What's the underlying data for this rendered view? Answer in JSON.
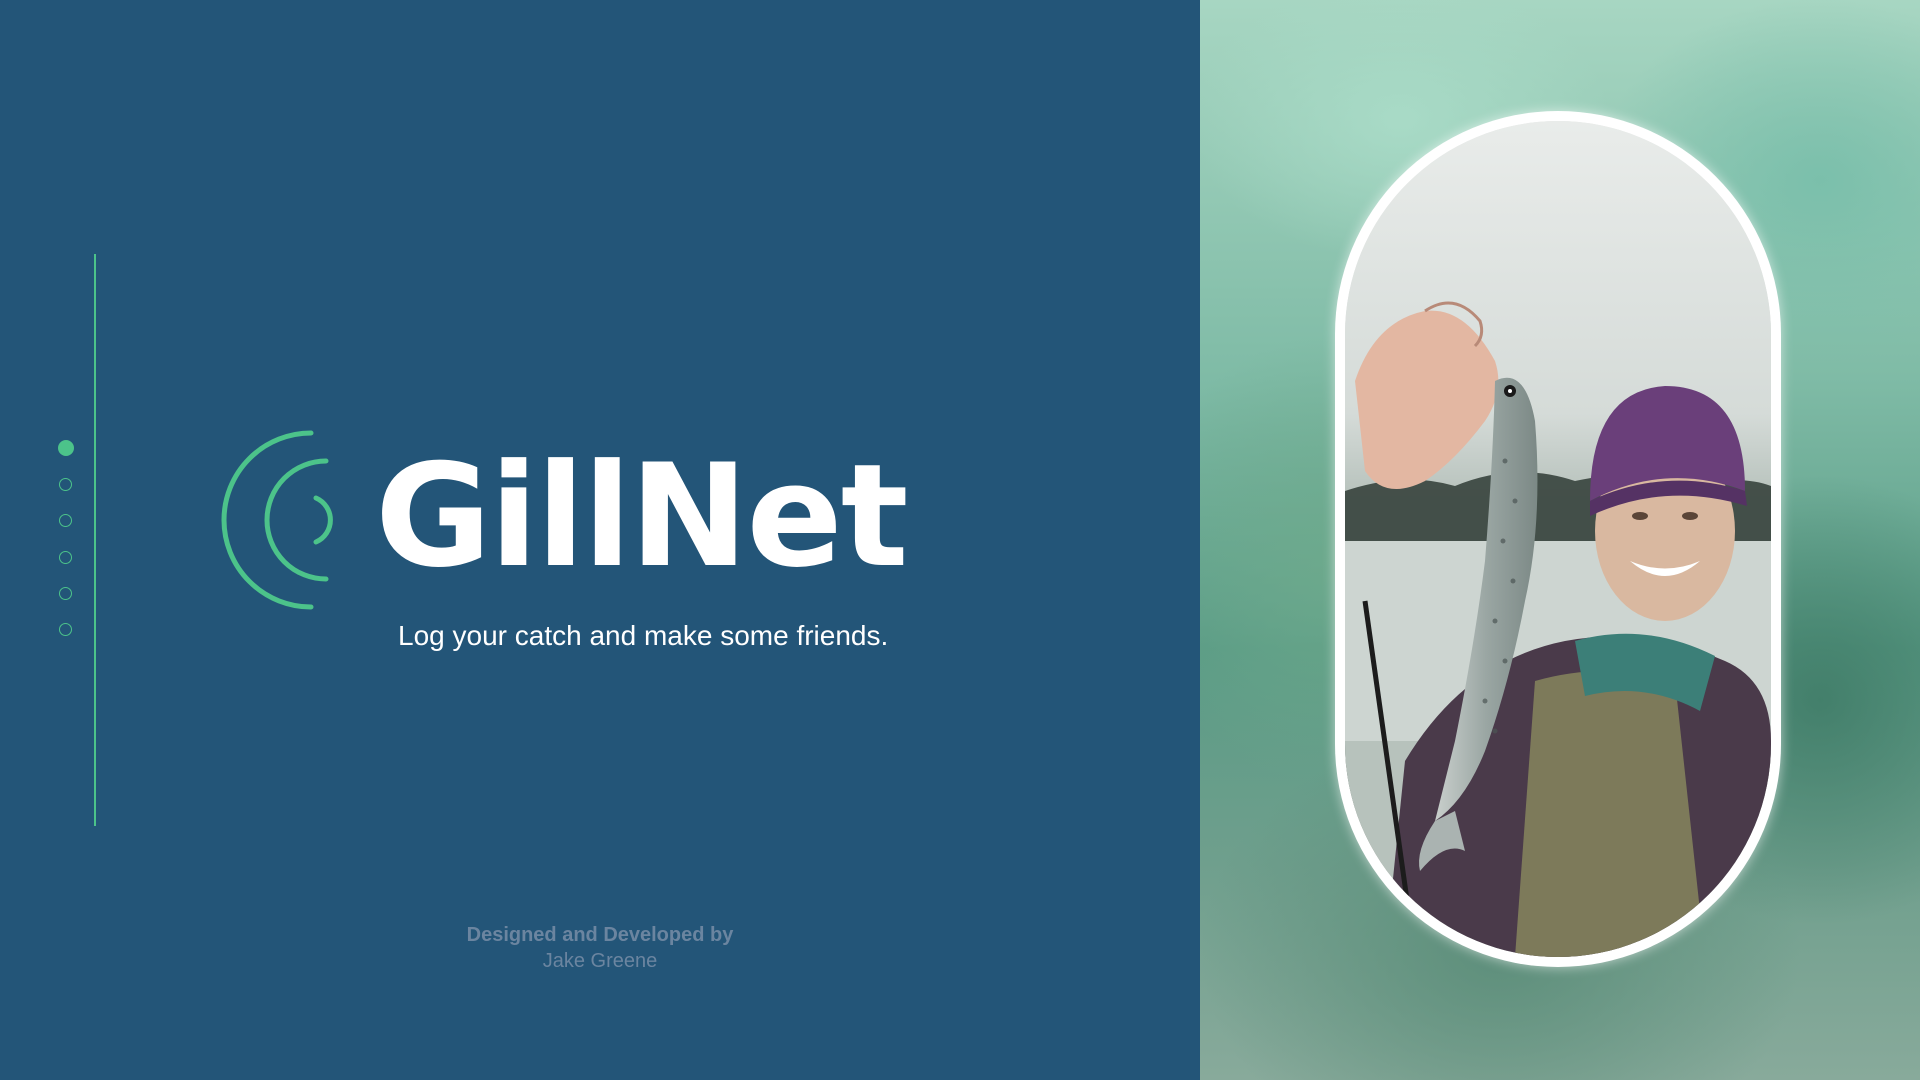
{
  "brand": {
    "name": "GillNet",
    "tagline": "Log your catch and make some friends.",
    "accent_color": "#4cc38a",
    "background_color": "#235578"
  },
  "credits": {
    "label": "Designed and Developed by",
    "author": "Jake Greene"
  },
  "pagination": {
    "total": 6,
    "active_index": 0
  },
  "hero_image": {
    "icon": "fisherman-holding-trout-photo"
  }
}
